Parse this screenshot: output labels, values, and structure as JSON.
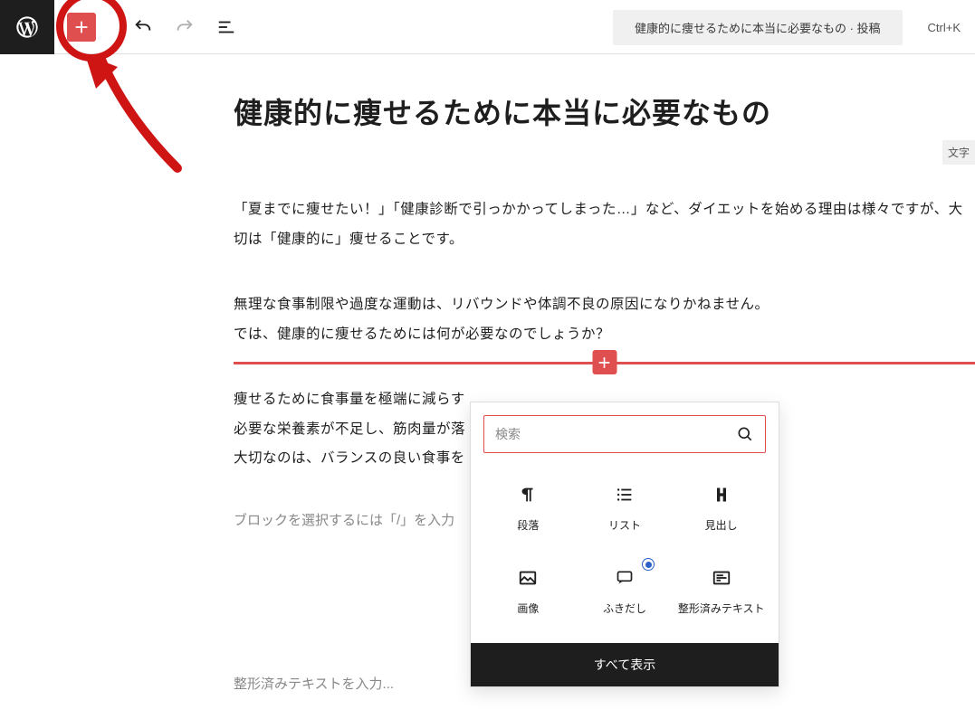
{
  "topbar": {
    "crumb": "健康的に痩せるために本当に必要なもの · 投稿",
    "shortcut": "Ctrl+K"
  },
  "editor": {
    "title": "健康的に痩せるために本当に必要なもの",
    "side_badge": "文字",
    "para1": "「夏までに痩せたい！」「健康診断で引っかかってしまった…」など、ダイエットを始める理由は様々ですが、大切は「健康的に」痩せることです。",
    "para2_l1": "無理な食事制限や過度な運動は、リバウンドや体調不良の原因になりかねません。",
    "para2_l2": "では、健康的に痩せるためには何が必要なのでしょうか？",
    "para3_l1": "痩せるために食事量を極端に減らす",
    "para3_l2": "必要な栄養素が不足し、筋肉量が落",
    "para3_l3": "大切なのは、バランスの良い食事を",
    "hint": "ブロックを選択するには「/」を入力",
    "pre_placeholder": "整形済みテキストを入力..."
  },
  "inserter": {
    "search_placeholder": "検索",
    "blocks": {
      "paragraph": "段落",
      "list": "リスト",
      "heading": "見出し",
      "image": "画像",
      "balloon": "ふきだし",
      "preformatted": "整形済みテキスト"
    },
    "show_all": "すべて表示"
  }
}
